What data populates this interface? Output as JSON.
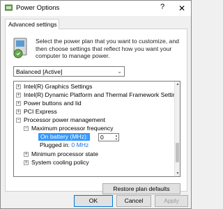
{
  "window": {
    "title": "Power Options",
    "help_glyph": "?",
    "close_glyph": "✕"
  },
  "tabs": [
    {
      "label": "Advanced settings"
    }
  ],
  "description": "Select the power plan that you want to customize, and then choose settings that reflect how you want your computer to manage power.",
  "plan_select": {
    "value": "Balanced [Active]"
  },
  "tree": {
    "items": [
      {
        "label": "Intel(R) Graphics Settings",
        "expander": "+",
        "indent": 0
      },
      {
        "label": "Intel(R) Dynamic Platform and Thermal Framework Settings",
        "expander": "+",
        "indent": 0
      },
      {
        "label": "Power buttons and lid",
        "expander": "+",
        "indent": 0
      },
      {
        "label": "PCI Express",
        "expander": "+",
        "indent": 0
      },
      {
        "label": "Processor power management",
        "expander": "−",
        "indent": 0
      },
      {
        "label": "Maximum processor frequency",
        "expander": "−",
        "indent": 1
      },
      {
        "label": "On battery (MHz):",
        "expander": "",
        "indent": 2,
        "value": "0"
      },
      {
        "label": "Plugged in:",
        "expander": "",
        "indent": 2,
        "value": "0 MHz"
      },
      {
        "label": "Minimum processor state",
        "expander": "+",
        "indent": 1
      },
      {
        "label": "System cooling policy",
        "expander": "+",
        "indent": 1
      }
    ]
  },
  "restore_button": {
    "label": "Restore plan defaults"
  },
  "footer": {
    "ok": "OK",
    "cancel": "Cancel",
    "apply": "Apply"
  },
  "colors": {
    "accent": "#3399ff",
    "link_value": "#1e6fd9",
    "ok_border": "#0078d7"
  }
}
